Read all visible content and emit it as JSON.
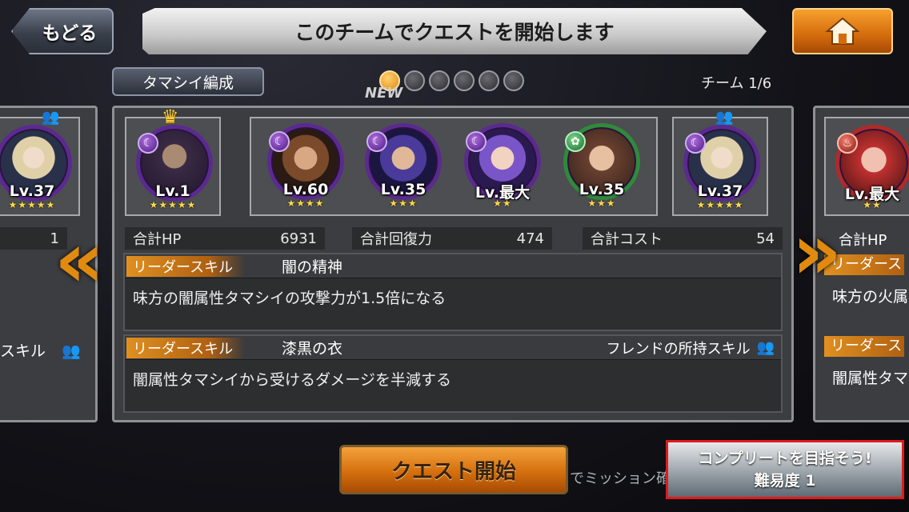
{
  "header": {
    "back_label": "もどる",
    "title": "このチームでクエストを開始します",
    "home_icon": "home-icon"
  },
  "subheader": {
    "tab_label": "タマシイ編成",
    "team_label": "チーム",
    "team_page": "1/6",
    "new_label": "NEW",
    "pages": 6,
    "active_page": 1
  },
  "left_preview": {
    "level": "Lv.37",
    "stars": "★★★★★",
    "stat_value": "1",
    "skill_label": "スキル"
  },
  "team": [
    {
      "level": "Lv.1",
      "stars": "★★★★★",
      "leader": true,
      "attribute": "dark"
    },
    {
      "level": "Lv.60",
      "stars": "★★★★",
      "attribute": "dark"
    },
    {
      "level": "Lv.35",
      "stars": "★★★",
      "attribute": "dark"
    },
    {
      "level": "Lv.最大",
      "stars": "★★",
      "attribute": "dark"
    },
    {
      "level": "Lv.35",
      "stars": "★★★",
      "attribute": "green"
    },
    {
      "level": "Lv.37",
      "stars": "★★★★★",
      "friend": true,
      "attribute": "dark"
    }
  ],
  "right_preview": {
    "level": "Lv.最大",
    "stars": "★★",
    "stat_label": "合計HP",
    "skill_tag": "リーダース",
    "skill_desc": "味方の火属",
    "skill_tag2": "リーダース",
    "skill_desc2": "闇属性タマ"
  },
  "stats": {
    "hp_label": "合計HP",
    "hp_value": "6931",
    "recovery_label": "合計回復力",
    "recovery_value": "474",
    "cost_label": "合計コスト",
    "cost_value": "54"
  },
  "leader_skill": {
    "tag": "リーダースキル",
    "name": "闇の精神",
    "desc": "味方の闇属性タマシイの攻撃力が1.5倍になる"
  },
  "friend_skill": {
    "tag": "リーダースキル",
    "name": "漆黒の衣",
    "friend_label": "フレンドの所持スキル",
    "desc": "闇属性タマシイから受けるダメージを半減する"
  },
  "footer": {
    "start_label": "クエスト開始",
    "mission_text": "でミッション確",
    "complete_line1": "コンプリートを目指そう!",
    "complete_line2": "難易度 1"
  },
  "colors": {
    "accent_orange": "#e08a10",
    "dark_attribute": "#5b2a8f",
    "highlight_border": "#e01a1a"
  }
}
